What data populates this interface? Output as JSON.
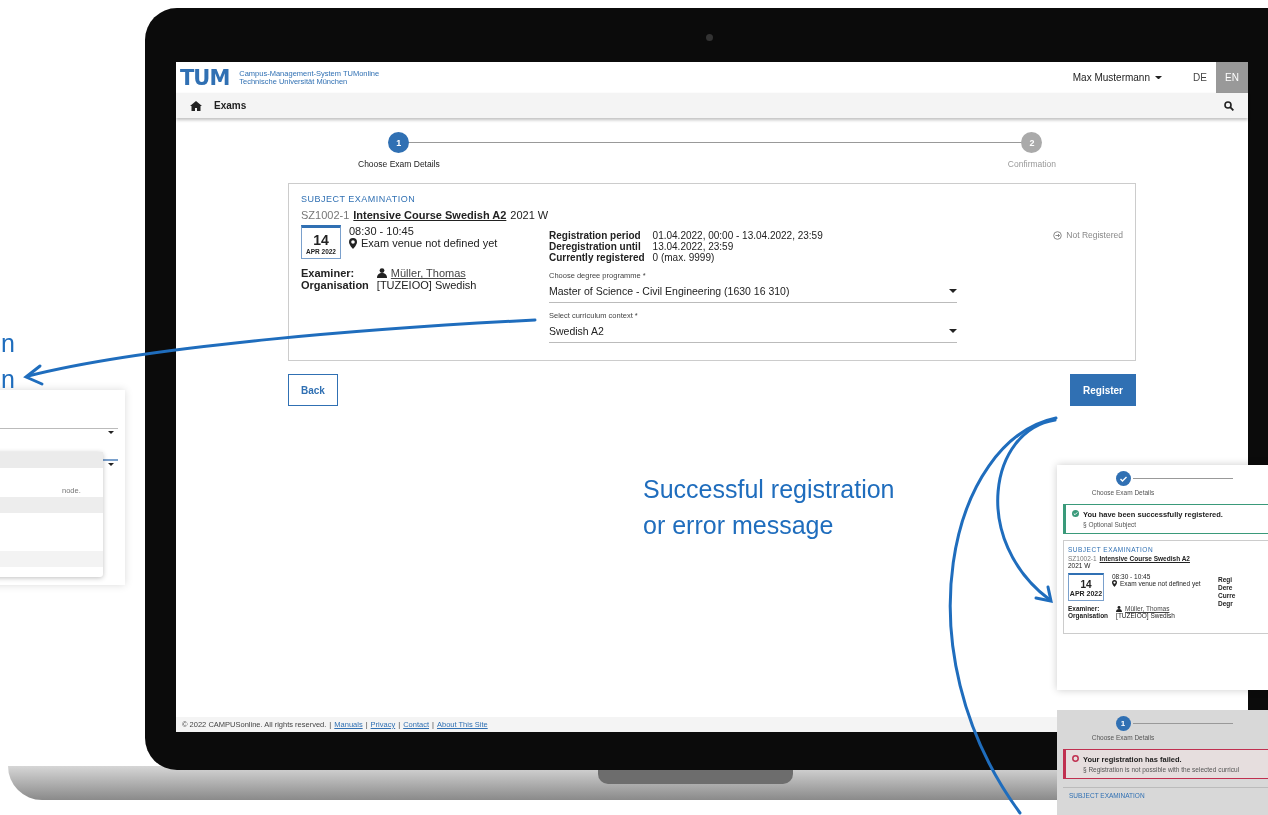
{
  "left_callout": {
    "lines": [
      "n",
      "n"
    ]
  },
  "left_panel": {
    "note": "node."
  },
  "screen": {
    "header": {
      "logo": "TUM",
      "system_lines": [
        "Campus-Management-System TUMonline",
        "Technische Universität München"
      ],
      "user": "Max Mustermann",
      "languages": [
        {
          "label": "DE",
          "selected": false
        },
        {
          "label": "EN",
          "selected": true
        }
      ]
    },
    "nav": {
      "title": "Exams"
    },
    "steps": [
      {
        "number": "1",
        "label": "Choose Exam Details",
        "current": true
      },
      {
        "number": "2",
        "label": "Confirmation",
        "current": false
      }
    ],
    "exam": {
      "type": "SUBJECT EXAMINATION",
      "code": "SZ1002-1",
      "title": "Intensive Course Swedish A2",
      "semester": "2021 W",
      "day": "14",
      "month": "APR 2022",
      "time": "08:30 - 10:45",
      "venue": "Exam venue not defined yet",
      "examiner_label": "Examiner:",
      "examiner": "Müller, Thomas",
      "org_label": "Organisation",
      "org": "[TUZEIOO] Swedish",
      "details": [
        {
          "label": "Registration period",
          "value": "01.04.2022, 00:00 - 13.04.2022, 23:59"
        },
        {
          "label": "Deregistration until",
          "value": "13.04.2022, 23:59"
        },
        {
          "label": "Currently registered",
          "value": "0 (max. 9999)"
        }
      ],
      "status": "Not Registered",
      "selects": [
        {
          "label": "Choose degree programme *",
          "value": "Master of Science - Civil Engineering (1630 16 310)"
        },
        {
          "label": "Select curriculum context *",
          "value": "Swedish A2"
        }
      ]
    },
    "back_button": "Back",
    "register_button": "Register",
    "footer": {
      "copyright": "© 2022 CAMPUSonline. All rights reserved.",
      "separator": "|",
      "links": [
        "Manuals",
        "Privacy",
        "Contact",
        "About This Site"
      ]
    }
  },
  "center_callout": {
    "lines": [
      "Successful registration",
      "or error message"
    ]
  },
  "success_panel": {
    "step": {
      "kind": "done",
      "label": "Choose Exam Details"
    },
    "message": "You have been successfully registered.",
    "sub": "§ Optional Subject",
    "exam": {
      "type": "SUBJECT EXAMINATION",
      "code": "SZ1002-1",
      "title": "Intensive Course Swedish A2",
      "semester": "2021 W",
      "day": "14",
      "month": "APR 2022",
      "time": "08:30 - 10:45",
      "venue": "Exam venue not defined yet",
      "examiner_label": "Examiner:",
      "examiner": "Müller, Thomas",
      "org_label": "Organisation",
      "org": "[TUZEIOO] Swedish",
      "detail_labels": [
        "Regi",
        "Dere",
        "Curre",
        "Degr"
      ]
    }
  },
  "failure_panel": {
    "step": {
      "kind": "number",
      "number": "1",
      "label": "Choose Exam Details"
    },
    "message": "Your registration has failed.",
    "sub": "§ Registration is not possible with the selected curricul",
    "type": "SUBJECT EXAMINATION"
  }
}
